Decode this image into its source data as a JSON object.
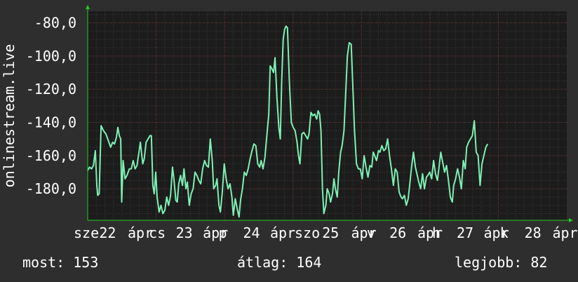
{
  "chart_data": {
    "type": "line",
    "title": "",
    "xlabel": "",
    "ylabel": "onlinestream.live",
    "ylim": [
      -199,
      -73
    ],
    "y_ticks": [
      {
        "value": -80,
        "label": "-80,0"
      },
      {
        "value": -100,
        "label": "-100,0"
      },
      {
        "value": -120,
        "label": "-120,0"
      },
      {
        "value": -140,
        "label": "-140,0"
      },
      {
        "value": -160,
        "label": "-160,0"
      },
      {
        "value": -180,
        "label": "-180,0"
      }
    ],
    "x_tick_labels": [
      "sze",
      "22",
      "ápr",
      "csü",
      "23",
      "ápr",
      "pén",
      "24",
      "ápr",
      "szo",
      "25",
      "ápr",
      "vas",
      "26",
      "ápr",
      "hét",
      "27",
      "ápr",
      "kedd",
      "28",
      "ápr"
    ],
    "x_labels_display": [
      {
        "text": "sze",
        "pos": 0.0
      },
      {
        "text": "22",
        "pos": 0.052
      },
      {
        "text": "ápr",
        "pos": 0.11
      },
      {
        "text": "cs",
        "pos": 0.153
      },
      {
        "text": "23",
        "pos": 0.208
      },
      {
        "text": "ápr",
        "pos": 0.263
      },
      {
        "text": "p",
        "pos": 0.295
      },
      {
        "text": "24",
        "pos": 0.345
      },
      {
        "text": "ápr",
        "pos": 0.4
      },
      {
        "text": "szo",
        "pos": 0.45
      },
      {
        "text": "25",
        "pos": 0.506
      },
      {
        "text": "ápr",
        "pos": 0.565
      },
      {
        "text": "v",
        "pos": 0.597
      },
      {
        "text": "26",
        "pos": 0.643
      },
      {
        "text": "ápr",
        "pos": 0.7
      },
      {
        "text": "h",
        "pos": 0.73
      },
      {
        "text": "27",
        "pos": 0.78
      },
      {
        "text": "ápr",
        "pos": 0.835
      },
      {
        "text": "k",
        "pos": 0.868
      },
      {
        "text": "28",
        "pos": 0.918
      },
      {
        "text": "ápr",
        "pos": 0.975
      }
    ],
    "x_range": [
      0,
      1
    ],
    "grid": true,
    "legend": "none",
    "series": [
      {
        "color": "#7ef0b4",
        "points": [
          [
            0.0,
            -169
          ],
          [
            0.004,
            -167
          ],
          [
            0.008,
            -168
          ],
          [
            0.012,
            -166
          ],
          [
            0.016,
            -157
          ],
          [
            0.019,
            -178
          ],
          [
            0.021,
            -184
          ],
          [
            0.024,
            -183
          ],
          [
            0.028,
            -142
          ],
          [
            0.033,
            -145
          ],
          [
            0.038,
            -147
          ],
          [
            0.043,
            -151
          ],
          [
            0.048,
            -155
          ],
          [
            0.052,
            -152
          ],
          [
            0.056,
            -153
          ],
          [
            0.06,
            -149
          ],
          [
            0.063,
            -143
          ],
          [
            0.066,
            -148
          ],
          [
            0.069,
            -150
          ],
          [
            0.071,
            -188
          ],
          [
            0.074,
            -163
          ],
          [
            0.078,
            -174
          ],
          [
            0.082,
            -172
          ],
          [
            0.087,
            -168
          ],
          [
            0.091,
            -168
          ],
          [
            0.095,
            -163
          ],
          [
            0.099,
            -168
          ],
          [
            0.103,
            -166
          ],
          [
            0.107,
            -158
          ],
          [
            0.11,
            -152
          ],
          [
            0.115,
            -165
          ],
          [
            0.118,
            -162
          ],
          [
            0.122,
            -152
          ],
          [
            0.126,
            -150
          ],
          [
            0.13,
            -148
          ],
          [
            0.133,
            -148
          ],
          [
            0.136,
            -178
          ],
          [
            0.139,
            -183
          ],
          [
            0.142,
            -170
          ],
          [
            0.145,
            -185
          ],
          [
            0.149,
            -194
          ],
          [
            0.153,
            -190
          ],
          [
            0.157,
            -195
          ],
          [
            0.161,
            -193
          ],
          [
            0.165,
            -185
          ],
          [
            0.169,
            -190
          ],
          [
            0.173,
            -184
          ],
          [
            0.177,
            -167
          ],
          [
            0.18,
            -174
          ],
          [
            0.184,
            -187
          ],
          [
            0.187,
            -188
          ],
          [
            0.19,
            -177
          ],
          [
            0.194,
            -172
          ],
          [
            0.198,
            -178
          ],
          [
            0.201,
            -168
          ],
          [
            0.205,
            -180
          ],
          [
            0.208,
            -176
          ],
          [
            0.212,
            -190
          ],
          [
            0.216,
            -183
          ],
          [
            0.22,
            -180
          ],
          [
            0.224,
            -170
          ],
          [
            0.228,
            -172
          ],
          [
            0.232,
            -175
          ],
          [
            0.236,
            -177
          ],
          [
            0.24,
            -168
          ],
          [
            0.244,
            -163
          ],
          [
            0.248,
            -166
          ],
          [
            0.252,
            -167
          ],
          [
            0.256,
            -150
          ],
          [
            0.26,
            -163
          ],
          [
            0.263,
            -180
          ],
          [
            0.267,
            -178
          ],
          [
            0.27,
            -174
          ],
          [
            0.274,
            -190
          ],
          [
            0.277,
            -194
          ],
          [
            0.281,
            -182
          ],
          [
            0.285,
            -165
          ],
          [
            0.289,
            -174
          ],
          [
            0.293,
            -180
          ],
          [
            0.297,
            -177
          ],
          [
            0.301,
            -185
          ],
          [
            0.304,
            -196
          ],
          [
            0.308,
            -186
          ],
          [
            0.312,
            -192
          ],
          [
            0.316,
            -197
          ],
          [
            0.319,
            -187
          ],
          [
            0.323,
            -180
          ],
          [
            0.327,
            -170
          ],
          [
            0.331,
            -172
          ],
          [
            0.335,
            -168
          ],
          [
            0.339,
            -162
          ],
          [
            0.343,
            -157
          ],
          [
            0.347,
            -153
          ],
          [
            0.351,
            -154
          ],
          [
            0.355,
            -165
          ],
          [
            0.359,
            -167
          ],
          [
            0.362,
            -163
          ],
          [
            0.366,
            -168
          ],
          [
            0.37,
            -161
          ],
          [
            0.374,
            -148
          ],
          [
            0.378,
            -135
          ],
          [
            0.381,
            -106
          ],
          [
            0.385,
            -108
          ],
          [
            0.388,
            -110
          ],
          [
            0.391,
            -101
          ],
          [
            0.395,
            -125
          ],
          [
            0.399,
            -143
          ],
          [
            0.402,
            -150
          ],
          [
            0.405,
            -115
          ],
          [
            0.408,
            -90
          ],
          [
            0.411,
            -84
          ],
          [
            0.414,
            -82
          ],
          [
            0.417,
            -83
          ],
          [
            0.421,
            -115
          ],
          [
            0.425,
            -140
          ],
          [
            0.429,
            -143
          ],
          [
            0.433,
            -145
          ],
          [
            0.437,
            -152
          ],
          [
            0.44,
            -160
          ],
          [
            0.443,
            -165
          ],
          [
            0.447,
            -147
          ],
          [
            0.451,
            -146
          ],
          [
            0.455,
            -148
          ],
          [
            0.459,
            -150
          ],
          [
            0.462,
            -147
          ],
          [
            0.466,
            -134
          ],
          [
            0.47,
            -136
          ],
          [
            0.474,
            -135
          ],
          [
            0.478,
            -138
          ],
          [
            0.481,
            -133
          ],
          [
            0.484,
            -135
          ],
          [
            0.487,
            -145
          ],
          [
            0.49,
            -180
          ],
          [
            0.493,
            -195
          ],
          [
            0.497,
            -190
          ],
          [
            0.5,
            -180
          ],
          [
            0.504,
            -183
          ],
          [
            0.507,
            -188
          ],
          [
            0.511,
            -183
          ],
          [
            0.514,
            -174
          ],
          [
            0.517,
            -180
          ],
          [
            0.521,
            -185
          ],
          [
            0.524,
            -170
          ],
          [
            0.528,
            -158
          ],
          [
            0.531,
            -154
          ],
          [
            0.535,
            -145
          ],
          [
            0.539,
            -120
          ],
          [
            0.542,
            -100
          ],
          [
            0.546,
            -92
          ],
          [
            0.55,
            -93
          ],
          [
            0.553,
            -115
          ],
          [
            0.557,
            -145
          ],
          [
            0.561,
            -165
          ],
          [
            0.565,
            -168
          ],
          [
            0.569,
            -168
          ],
          [
            0.573,
            -174
          ],
          [
            0.577,
            -160
          ],
          [
            0.581,
            -167
          ],
          [
            0.585,
            -173
          ],
          [
            0.589,
            -166
          ],
          [
            0.593,
            -167
          ],
          [
            0.596,
            -158
          ],
          [
            0.599,
            -160
          ],
          [
            0.603,
            -163
          ],
          [
            0.607,
            -157
          ],
          [
            0.61,
            -158
          ],
          [
            0.614,
            -154
          ],
          [
            0.618,
            -157
          ],
          [
            0.622,
            -156
          ],
          [
            0.626,
            -150
          ],
          [
            0.63,
            -160
          ],
          [
            0.634,
            -168
          ],
          [
            0.638,
            -178
          ],
          [
            0.642,
            -168
          ],
          [
            0.646,
            -170
          ],
          [
            0.65,
            -182
          ],
          [
            0.654,
            -185
          ],
          [
            0.657,
            -186
          ],
          [
            0.661,
            -184
          ],
          [
            0.665,
            -190
          ],
          [
            0.669,
            -186
          ],
          [
            0.672,
            -178
          ],
          [
            0.676,
            -167
          ],
          [
            0.68,
            -158
          ],
          [
            0.684,
            -167
          ],
          [
            0.688,
            -172
          ],
          [
            0.691,
            -176
          ],
          [
            0.695,
            -180
          ],
          [
            0.699,
            -171
          ],
          [
            0.703,
            -180
          ],
          [
            0.707,
            -173
          ],
          [
            0.71,
            -172
          ],
          [
            0.714,
            -170
          ],
          [
            0.718,
            -174
          ],
          [
            0.722,
            -163
          ],
          [
            0.726,
            -171
          ],
          [
            0.73,
            -175
          ],
          [
            0.733,
            -168
          ],
          [
            0.737,
            -158
          ],
          [
            0.741,
            -164
          ],
          [
            0.745,
            -170
          ],
          [
            0.749,
            -166
          ],
          [
            0.753,
            -175
          ],
          [
            0.757,
            -185
          ],
          [
            0.761,
            -188
          ],
          [
            0.764,
            -178
          ],
          [
            0.768,
            -174
          ],
          [
            0.772,
            -168
          ],
          [
            0.776,
            -173
          ],
          [
            0.78,
            -180
          ],
          [
            0.784,
            -163
          ],
          [
            0.788,
            -168
          ],
          [
            0.791,
            -155
          ],
          [
            0.795,
            -152
          ],
          [
            0.799,
            -150
          ],
          [
            0.803,
            -148
          ],
          [
            0.807,
            -139
          ],
          [
            0.811,
            -158
          ],
          [
            0.815,
            -160
          ],
          [
            0.819,
            -178
          ],
          [
            0.823,
            -165
          ],
          [
            0.827,
            -160
          ],
          [
            0.831,
            -155
          ],
          [
            0.835,
            -153
          ]
        ]
      }
    ]
  },
  "footer": {
    "now": "most: 153",
    "avg": "átlag: 164",
    "best": "legjobb: 82"
  },
  "colors": {
    "background": "#2e2e2e",
    "plot_background": "#1c1c1c",
    "grid_major": "#5a2a2a",
    "grid_minor": "#3a3a3a",
    "line": "#7ef0b4",
    "axis_arrow": "#22cc22",
    "text": "#ffffff"
  }
}
